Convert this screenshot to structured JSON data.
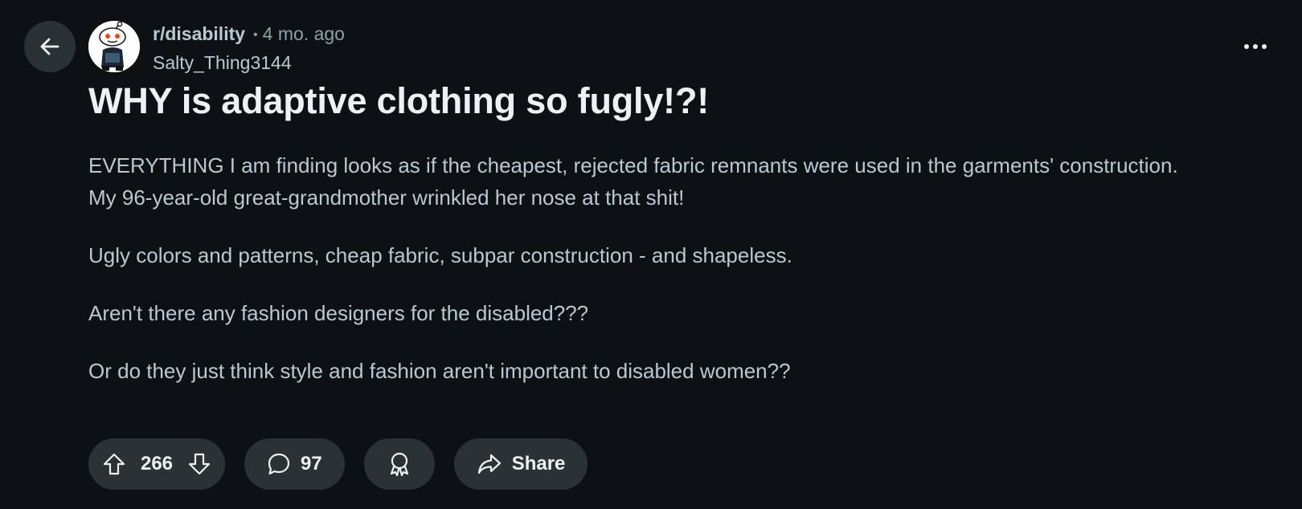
{
  "header": {
    "back_icon": "arrow-left-icon",
    "subreddit": "r/disability",
    "separator": "•",
    "time_ago": "4 mo. ago",
    "author": "Salty_Thing3144",
    "overflow_icon": "ellipsis-icon"
  },
  "post": {
    "title": "WHY is adaptive clothing so fugly!?!",
    "paragraphs": [
      "EVERYTHING I am finding looks as if the cheapest, rejected fabric remnants were used in the garments' construction. My 96-year-old great-grandmother wrinkled her nose at that shit!",
      "Ugly colors and patterns, cheap fabric, subpar construction - and shapeless.",
      "Aren't there any fashion designers for the disabled???",
      "Or do they just think style and fashion aren't important to disabled women??"
    ]
  },
  "actions": {
    "vote_count": "266",
    "comment_count": "97",
    "share_label": "Share"
  },
  "colors": {
    "background": "#0e1113",
    "pill": "#2a3236",
    "title": "#eef1f3",
    "text": "#b7cad4",
    "muted": "#8ba2ad"
  }
}
